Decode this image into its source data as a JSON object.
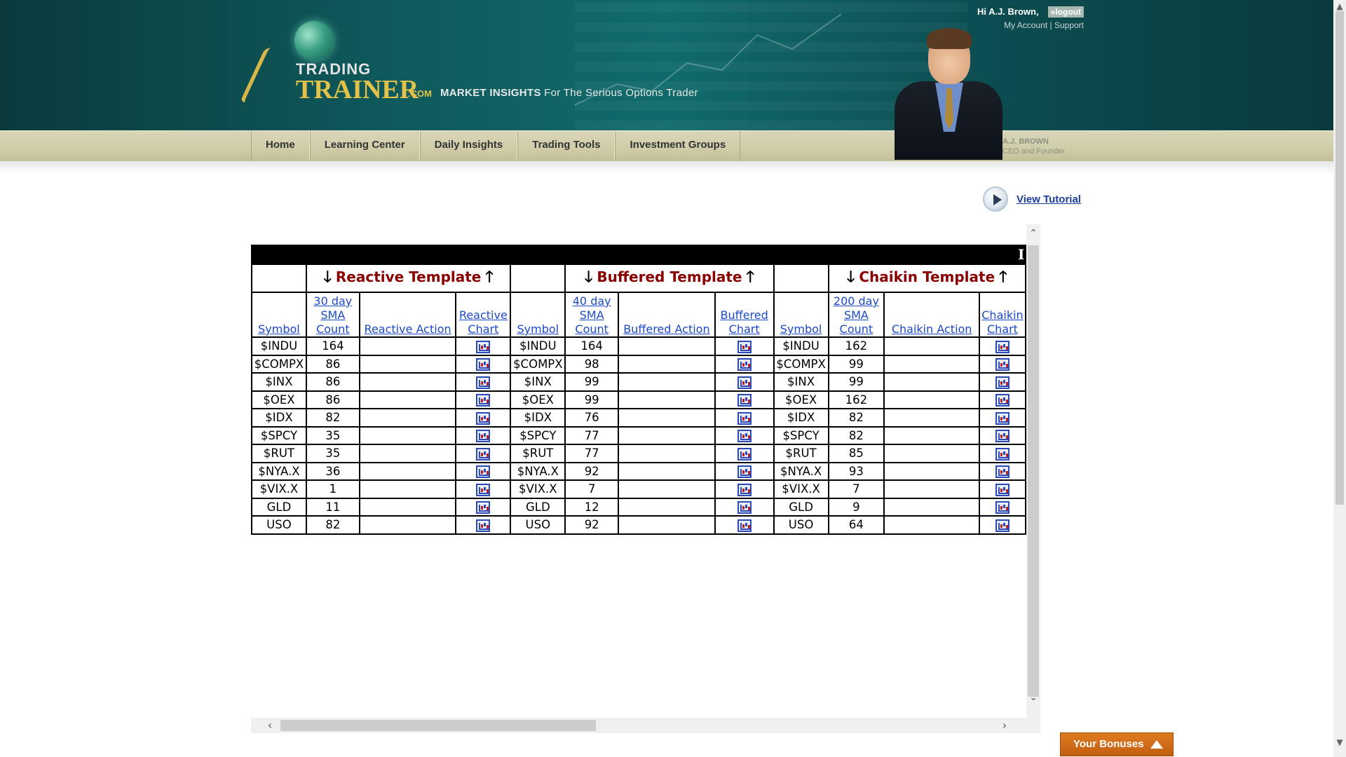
{
  "header": {
    "logo": {
      "line1": "TRADING",
      "line2": "TRAINER",
      "suffix": ".COM"
    },
    "tagline_strong": "MARKET INSIGHTS",
    "tagline_rest": "For The Serious Options Trader",
    "greeting": "Hi A.J. Brown,",
    "logout_label": "»logout",
    "account_link": "My Account",
    "separator": "|",
    "support_link": "Support",
    "founder_name": "A.J. BROWN",
    "founder_title": "CEO and Founder"
  },
  "nav": {
    "items": [
      {
        "label": "Home"
      },
      {
        "label": "Learning Center"
      },
      {
        "label": "Daily Insights"
      },
      {
        "label": "Trading Tools"
      },
      {
        "label": "Investment Groups"
      }
    ]
  },
  "tutorial": {
    "label": "View Tutorial"
  },
  "table": {
    "topbar_clipped_letter": "I",
    "groups": [
      {
        "label": "Reactive Template"
      },
      {
        "label": "Buffered Template"
      },
      {
        "label": "Chaikin Template"
      }
    ],
    "columns": {
      "symbol": "Symbol",
      "reactive_count": "30 day SMA Count",
      "reactive_action": "Reactive Action",
      "reactive_chart": "Reactive Chart",
      "buffered_count": "40 day SMA Count",
      "buffered_action": "Buffered Action",
      "buffered_chart": "Buffered Chart",
      "chaikin_count": "200 day SMA Count",
      "chaikin_action": "Chaikin Action",
      "chaikin_chart": "Chaikin Chart"
    },
    "rows": [
      {
        "symbol": "$INDU",
        "reactive": "164",
        "buffered": "164",
        "chaikin": "162"
      },
      {
        "symbol": "$COMPX",
        "reactive": "86",
        "buffered": "98",
        "chaikin": "99"
      },
      {
        "symbol": "$INX",
        "reactive": "86",
        "buffered": "99",
        "chaikin": "99"
      },
      {
        "symbol": "$OEX",
        "reactive": "86",
        "buffered": "99",
        "chaikin": "162"
      },
      {
        "symbol": "$IDX",
        "reactive": "82",
        "buffered": "76",
        "chaikin": "82"
      },
      {
        "symbol": "$SPCY",
        "reactive": "35",
        "buffered": "77",
        "chaikin": "82"
      },
      {
        "symbol": "$RUT",
        "reactive": "35",
        "buffered": "77",
        "chaikin": "85"
      },
      {
        "symbol": "$NYA.X",
        "reactive": "36",
        "buffered": "92",
        "chaikin": "93"
      },
      {
        "symbol": "$VIX.X",
        "reactive": "1",
        "buffered": "7",
        "chaikin": "7"
      },
      {
        "symbol": "GLD",
        "reactive": "11",
        "buffered": "12",
        "chaikin": "9"
      },
      {
        "symbol": "USO",
        "reactive": "82",
        "buffered": "92",
        "chaikin": "64"
      }
    ]
  },
  "bonuses": {
    "label": "Your Bonuses"
  }
}
